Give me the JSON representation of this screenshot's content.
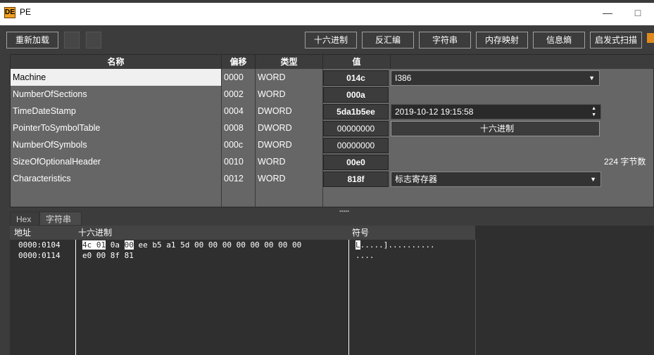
{
  "window": {
    "title": "PE",
    "logo_text": "DE"
  },
  "toolbar": {
    "reload": "重新加载",
    "hex": "十六进制",
    "disasm": "反汇编",
    "strings": "字符串",
    "memmap": "内存映射",
    "entropy": "信息熵",
    "heuristic": "启发式扫描"
  },
  "table": {
    "headers": {
      "name": "名称",
      "offset": "偏移",
      "type": "类型",
      "value": "值"
    },
    "rows": [
      {
        "name": "Machine",
        "offset": "0000",
        "type": "WORD",
        "value": "014c",
        "extra_kind": "combo",
        "extra": "I386"
      },
      {
        "name": "NumberOfSections",
        "offset": "0002",
        "type": "WORD",
        "value": "000a",
        "extra_kind": "none",
        "extra": ""
      },
      {
        "name": "TimeDateStamp",
        "offset": "0004",
        "type": "DWORD",
        "value": "5da1b5ee",
        "extra_kind": "spin",
        "extra": "2019-10-12 19:15:58"
      },
      {
        "name": "PointerToSymbolTable",
        "offset": "0008",
        "type": "DWORD",
        "value": "00000000",
        "extra_kind": "button",
        "extra": "十六进制"
      },
      {
        "name": "NumberOfSymbols",
        "offset": "000c",
        "type": "DWORD",
        "value": "00000000",
        "extra_kind": "none",
        "extra": ""
      },
      {
        "name": "SizeOfOptionalHeader",
        "offset": "0010",
        "type": "WORD",
        "value": "00e0",
        "extra_kind": "text",
        "extra": "224 字节数"
      },
      {
        "name": "Characteristics",
        "offset": "0012",
        "type": "WORD",
        "value": "818f",
        "extra_kind": "combo",
        "extra": "标志寄存器"
      }
    ]
  },
  "tabs": [
    "Hex",
    "字符串"
  ],
  "hex": {
    "headers": {
      "address": "地址",
      "hex": "十六进制",
      "symbols": "符号"
    },
    "lines": [
      {
        "address": "0000:0104",
        "hex_parts": [
          "4c 01",
          " 0a ",
          "00",
          " ee b5 a1 5d 00 00 00 00 00 00 00 00"
        ],
        "symbols": [
          "L",
          ".....].........."
        ]
      },
      {
        "address": "0000:0114",
        "hex_parts": [
          "",
          "",
          "",
          "e0 00 8f 81"
        ],
        "symbols": [
          "",
          "...."
        ]
      }
    ]
  }
}
